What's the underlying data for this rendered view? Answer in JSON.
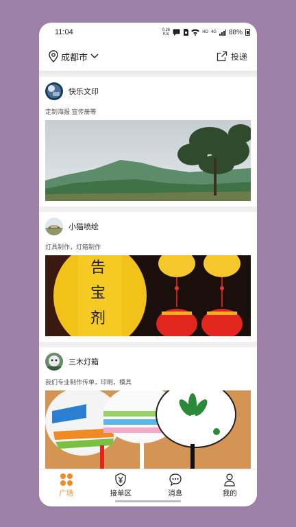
{
  "status_bar": {
    "time": "11:04",
    "network_speed_top": "0.26",
    "network_speed_bottom": "K/s",
    "hd_badge": "HD",
    "signal_badge": "4G",
    "battery": "88%"
  },
  "header": {
    "city": "成都市",
    "post_label": "投递"
  },
  "posts": [
    {
      "name": "快乐文印",
      "description": "定制海报 宣传册等"
    },
    {
      "name": "小猫喷绘",
      "description": "灯具制作，灯箱制作"
    },
    {
      "name": "三木灯箱",
      "description": "我们专业制作传单，印刷，模具"
    }
  ],
  "tabs": [
    {
      "label": "广场",
      "icon": "grid-icon",
      "active": true
    },
    {
      "label": "接单区",
      "icon": "yen-shield-icon",
      "active": false
    },
    {
      "label": "消息",
      "icon": "chat-bubble-icon",
      "active": false
    },
    {
      "label": "我的",
      "icon": "person-icon",
      "active": false
    }
  ],
  "colors": {
    "accent": "#f08a24",
    "background": "#9c80a8"
  }
}
